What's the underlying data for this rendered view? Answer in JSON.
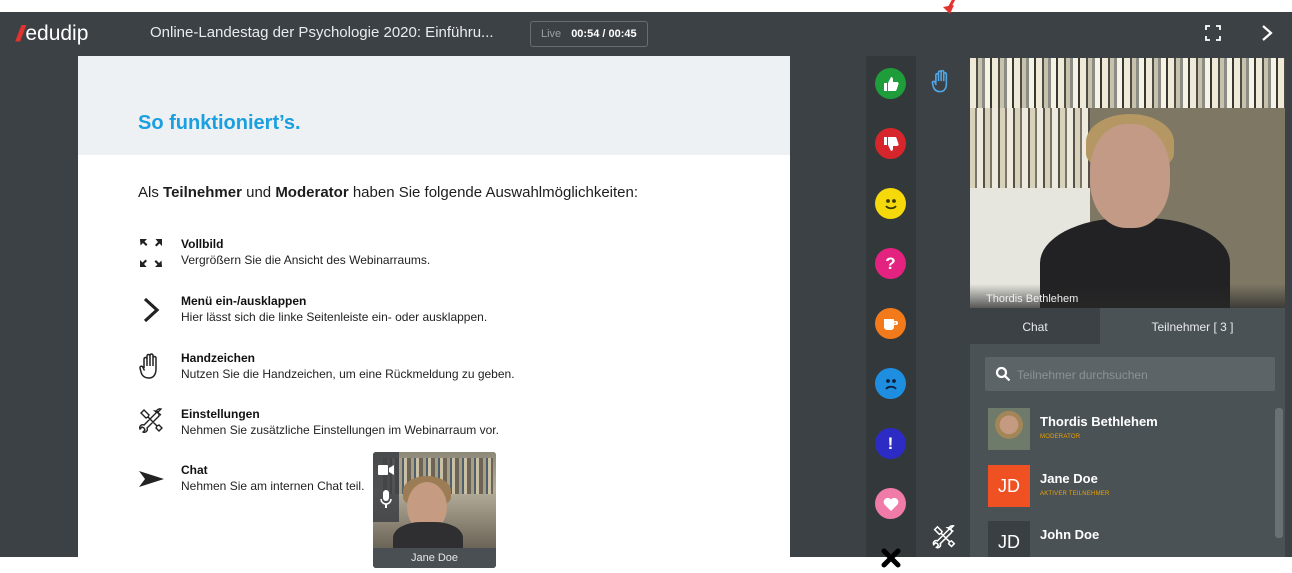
{
  "brand": {
    "mark": "///",
    "name": "edudip"
  },
  "header": {
    "title": "Online-Landestag der Psychologie 2020: Einführu...",
    "live_label": "Live",
    "time": "00:54 / 00:45"
  },
  "colors": {
    "accent_blue": "#1a9fe0",
    "brand_red": "#e2332f",
    "role_orange": "#e8a200"
  },
  "slide": {
    "title": "So funktioniert’s.",
    "intro_pre": "Als ",
    "intro_b1": "Teilnehmer",
    "intro_mid": " und ",
    "intro_b2": "Moderator",
    "intro_post": " haben Sie folgende Auswahlmöglichkeiten:",
    "features": [
      {
        "icon": "fullscreen-icon",
        "title": "Vollbild",
        "desc": "Vergrößern Sie die Ansicht des Webinarraums."
      },
      {
        "icon": "chevron-right-icon",
        "title": "Menü ein-/ausklappen",
        "desc": "Hier lässt sich die linke Seitenleiste ein- oder ausklappen."
      },
      {
        "icon": "hand-icon",
        "title": "Handzeichen",
        "desc": "Nutzen Sie die Handzeichen, um eine Rückmeldung zu geben."
      },
      {
        "icon": "tools-icon",
        "title": "Einstellungen",
        "desc": "Nehmen Sie zusätzliche Einstellungen im Webinarraum vor."
      },
      {
        "icon": "send-icon",
        "title": "Chat",
        "desc": "Nehmen Sie am internen Chat teil."
      }
    ]
  },
  "pip": {
    "name": "Jane Doe"
  },
  "reactions": [
    {
      "name": "thumbs-up",
      "glyph": "👍",
      "color": "#1f9d3a"
    },
    {
      "name": "thumbs-down",
      "glyph": "👎",
      "color": "#d7262b"
    },
    {
      "name": "smile",
      "glyph": "☺",
      "color": "#f5d90a"
    },
    {
      "name": "question",
      "glyph": "?",
      "color": "#e3237f"
    },
    {
      "name": "coffee",
      "glyph": "☕",
      "color": "#f27a1a"
    },
    {
      "name": "sad",
      "glyph": "☹",
      "color": "#1e8fe0"
    },
    {
      "name": "exclamation",
      "glyph": "!",
      "color": "#2c2cc4"
    },
    {
      "name": "heart",
      "glyph": "♥",
      "color": "#f07aa8"
    },
    {
      "name": "close",
      "glyph": "✖",
      "color": "#33383b"
    }
  ],
  "presenter": {
    "name": "Thordis Bethlehem"
  },
  "tabs": {
    "chat": "Chat",
    "participants": "Teilnehmer [ 3 ]"
  },
  "search": {
    "placeholder": "Teilnehmer durchsuchen"
  },
  "participants": [
    {
      "name": "Thordis Bethlehem",
      "role": "MODERATOR",
      "initials": ""
    },
    {
      "name": "Jane Doe",
      "role": "AKTIVER TEILNEHMER",
      "initials": "JD"
    },
    {
      "name": "John Doe",
      "role": "",
      "initials": "JD"
    }
  ]
}
